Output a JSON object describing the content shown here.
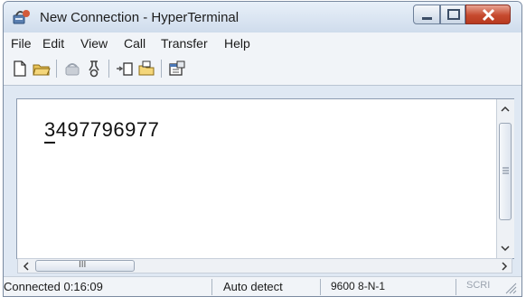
{
  "window": {
    "title": "New Connection - HyperTerminal",
    "app_icon": "hyperterminal-phone-icon",
    "controls": [
      "minimize-icon",
      "maximize-icon",
      "close-icon"
    ]
  },
  "menu": {
    "items": [
      "File",
      "Edit",
      "View",
      "Call",
      "Transfer",
      "Help"
    ]
  },
  "toolbar": {
    "buttons": [
      {
        "icon": "new-document-icon",
        "enabled": true
      },
      {
        "icon": "open-folder-icon",
        "enabled": true
      },
      {
        "icon": "call-icon",
        "enabled": false
      },
      {
        "icon": "disconnect-icon",
        "enabled": true
      },
      {
        "icon": "send-file-icon",
        "enabled": true
      },
      {
        "icon": "receive-file-icon",
        "enabled": true
      },
      {
        "icon": "properties-icon",
        "enabled": true
      }
    ]
  },
  "terminal": {
    "text": "3497796977"
  },
  "scrollbar": {
    "horizontal_thumb_label": "III"
  },
  "status": {
    "connection": "Connected 0:16:09",
    "detect": "Auto detect",
    "settings": "9600 8-N-1",
    "scroll": "SCRI"
  },
  "colors": {
    "title_gradient_top": "#e8f0f9",
    "close_button": "#c64a2e",
    "terminal_bg": "#ffffff"
  }
}
